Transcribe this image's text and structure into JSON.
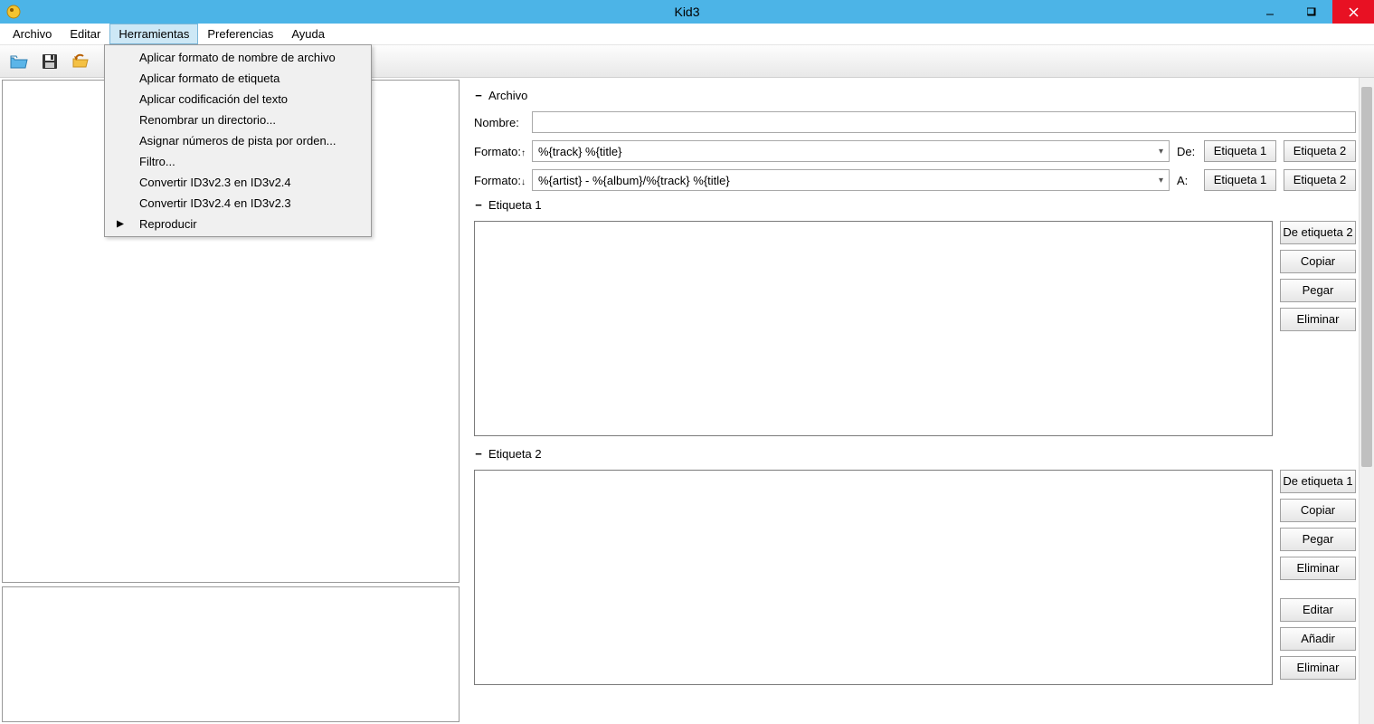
{
  "window": {
    "title": "Kid3"
  },
  "menu": {
    "archivo": "Archivo",
    "editar": "Editar",
    "herramientas": "Herramientas",
    "preferencias": "Preferencias",
    "ayuda": "Ayuda"
  },
  "dropdown": {
    "apply_filename_format": "Aplicar formato de nombre de archivo",
    "apply_tag_format": "Aplicar formato de etiqueta",
    "apply_text_encoding": "Aplicar codificación del texto",
    "rename_directory": "Renombrar un directorio...",
    "number_tracks": "Asignar números de pista por orden...",
    "filter": "Filtro...",
    "convert_23_24": "Convertir ID3v2.3 en ID3v2.4",
    "convert_24_23": "Convertir ID3v2.4 en ID3v2.3",
    "play": "Reproducir"
  },
  "file": {
    "section": "Archivo",
    "name_label": "Nombre:",
    "name_value": "",
    "format_label": "Formato:",
    "format1_value": "%{track} %{title}",
    "format2_value": "%{artist} - %{album}/%{track} %{title}",
    "from_label": "De:",
    "to_label": "A:",
    "tag1_btn": "Etiqueta 1",
    "tag2_btn": "Etiqueta 2"
  },
  "tag1": {
    "section": "Etiqueta 1",
    "from_tag2": "De etiqueta 2",
    "copy": "Copiar",
    "paste": "Pegar",
    "remove": "Eliminar"
  },
  "tag2": {
    "section": "Etiqueta 2",
    "from_tag1": "De etiqueta 1",
    "copy": "Copiar",
    "paste": "Pegar",
    "remove": "Eliminar",
    "edit": "Editar",
    "add": "Añadir",
    "delete": "Eliminar"
  }
}
